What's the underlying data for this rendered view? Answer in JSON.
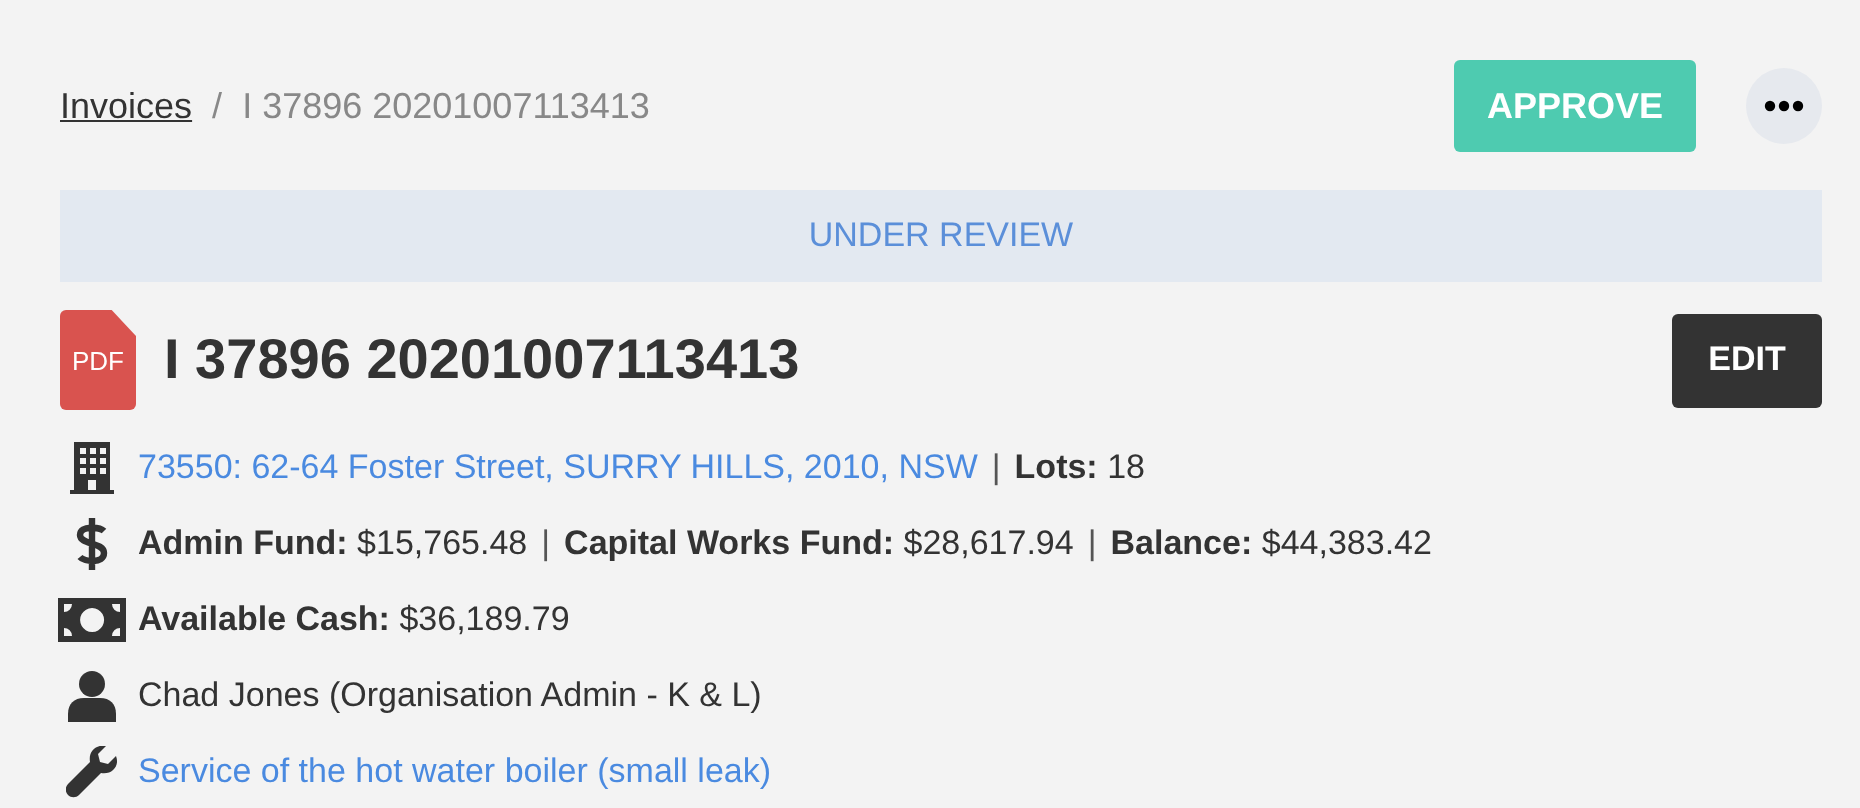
{
  "breadcrumb": {
    "link": "Invoices",
    "separator": "/",
    "current": "I 37896 20201007113413"
  },
  "actions": {
    "approve": "APPROVE"
  },
  "status_banner": "UNDER REVIEW",
  "document": {
    "badge": "PDF",
    "title": "I 37896 20201007113413",
    "edit": "EDIT"
  },
  "details": [
    {
      "kind": "property",
      "items": [
        {
          "kind": "link",
          "text": "73550: 62-64 Foster Street, SURRY HILLS, 2010, NSW"
        },
        {
          "kind": "separator",
          "text": "|"
        },
        {
          "kind": "field",
          "label": "Lots:",
          "value": "18"
        }
      ]
    },
    {
      "kind": "funds",
      "items": [
        {
          "kind": "field",
          "label": "Admin Fund:",
          "value": "$15,765.48"
        },
        {
          "kind": "separator",
          "text": "|"
        },
        {
          "kind": "field",
          "label": "Capital Works Fund:",
          "value": "$28,617.94"
        },
        {
          "kind": "separator",
          "text": "|"
        },
        {
          "kind": "field",
          "label": "Balance:",
          "value": "$44,383.42"
        }
      ]
    },
    {
      "kind": "cash",
      "items": [
        {
          "kind": "field",
          "label": "Available Cash:",
          "value": "$36,189.79"
        }
      ]
    },
    {
      "kind": "contact",
      "items": [
        {
          "kind": "text",
          "text": "Chad Jones (Organisation Admin - K & L)"
        }
      ]
    },
    {
      "kind": "work",
      "items": [
        {
          "kind": "link",
          "text": "Service of the hot water boiler (small leak)"
        }
      ]
    }
  ]
}
